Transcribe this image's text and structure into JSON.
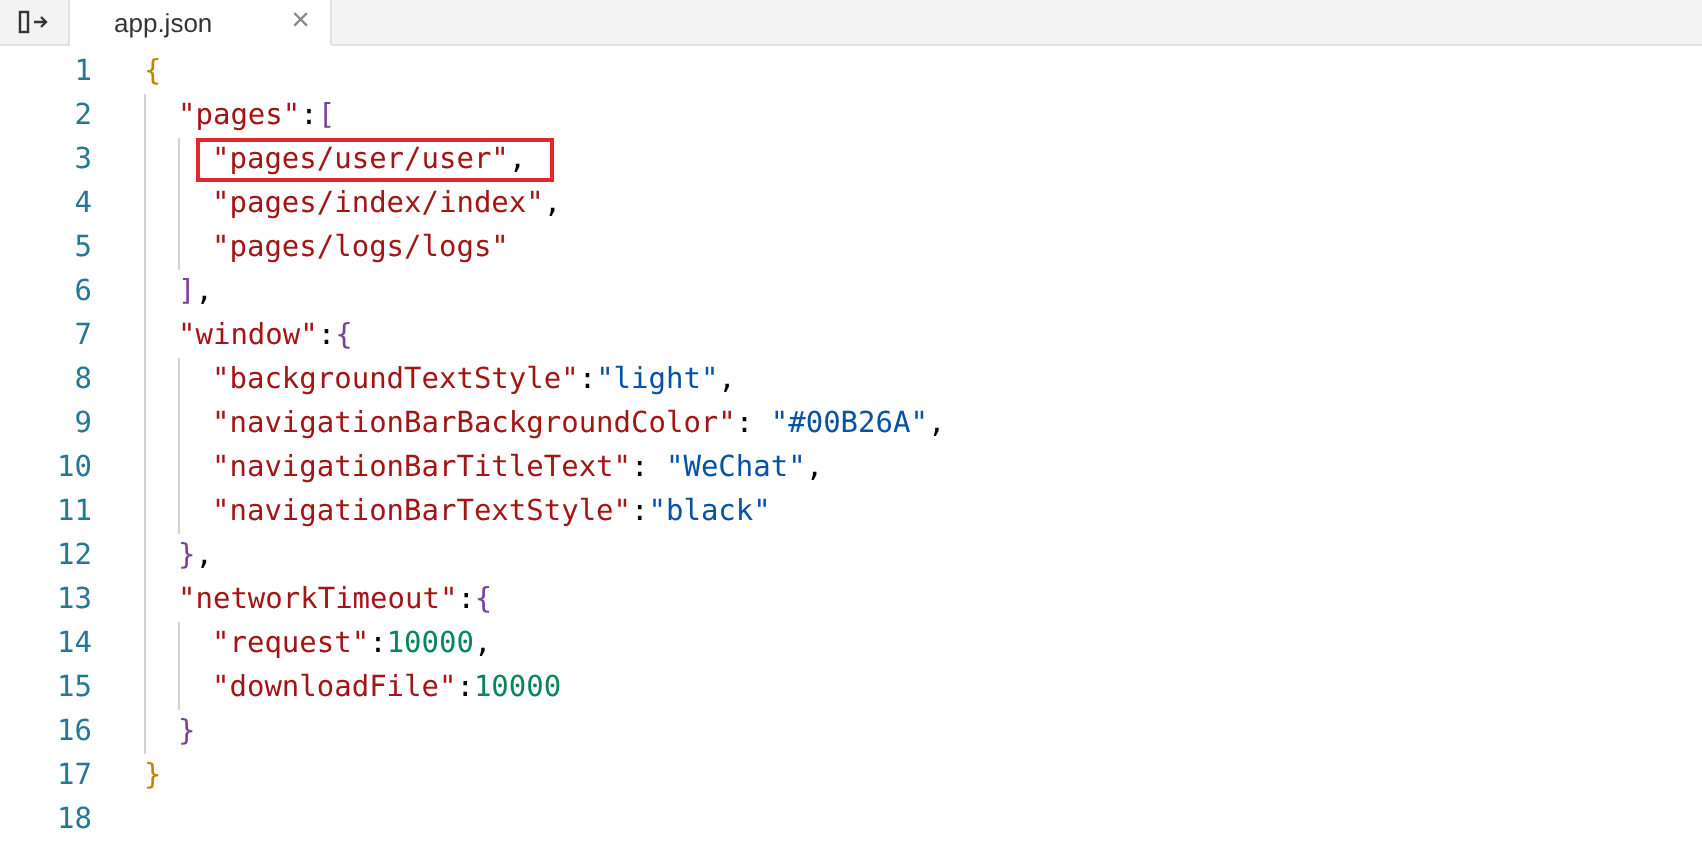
{
  "tabs": [
    {
      "label": "app.json",
      "selected": true,
      "close": "×"
    }
  ],
  "editor": {
    "lines": [
      {
        "number": "1",
        "highlighted": false,
        "tokens": [
          {
            "kind": "bracket1",
            "text": "{"
          }
        ],
        "children": [
          {
            "number": "2",
            "highlighted": false,
            "tokens": [
              {
                "kind": "key",
                "text": "\"pages\""
              },
              {
                "kind": "punct",
                "text": ":"
              },
              {
                "kind": "bracket2",
                "text": "["
              }
            ],
            "children": [
              {
                "number": "3",
                "highlighted": true,
                "tokens": [
                  {
                    "kind": "key",
                    "text": "\"pages/user/user\""
                  },
                  {
                    "kind": "punct",
                    "text": ","
                  }
                ]
              },
              {
                "number": "4",
                "highlighted": false,
                "tokens": [
                  {
                    "kind": "key",
                    "text": "\"pages/index/index\""
                  },
                  {
                    "kind": "punct",
                    "text": ","
                  }
                ]
              },
              {
                "number": "5",
                "highlighted": false,
                "tokens": [
                  {
                    "kind": "key",
                    "text": "\"pages/logs/logs\""
                  }
                ]
              }
            ]
          },
          {
            "number": "6",
            "highlighted": false,
            "tokens": [
              {
                "kind": "bracket2",
                "text": "]"
              },
              {
                "kind": "punct",
                "text": ","
              }
            ]
          },
          {
            "number": "7",
            "highlighted": false,
            "tokens": [
              {
                "kind": "key",
                "text": "\"window\""
              },
              {
                "kind": "punct",
                "text": ":"
              },
              {
                "kind": "bracket2",
                "text": "{"
              }
            ],
            "children": [
              {
                "number": "8",
                "highlighted": false,
                "tokens": [
                  {
                    "kind": "key",
                    "text": "\"backgroundTextStyle\""
                  },
                  {
                    "kind": "punct",
                    "text": ":"
                  },
                  {
                    "kind": "string",
                    "text": "\"light\""
                  },
                  {
                    "kind": "punct",
                    "text": ","
                  }
                ]
              },
              {
                "number": "9",
                "highlighted": false,
                "tokens": [
                  {
                    "kind": "key",
                    "text": "\"navigationBarBackgroundColor\""
                  },
                  {
                    "kind": "punct",
                    "text": ": "
                  },
                  {
                    "kind": "string",
                    "text": "\"#00B26A\""
                  },
                  {
                    "kind": "punct",
                    "text": ","
                  }
                ]
              },
              {
                "number": "10",
                "highlighted": false,
                "tokens": [
                  {
                    "kind": "key",
                    "text": "\"navigationBarTitleText\""
                  },
                  {
                    "kind": "punct",
                    "text": ": "
                  },
                  {
                    "kind": "string",
                    "text": "\"WeChat\""
                  },
                  {
                    "kind": "punct",
                    "text": ","
                  }
                ]
              },
              {
                "number": "11",
                "highlighted": false,
                "tokens": [
                  {
                    "kind": "key",
                    "text": "\"navigationBarTextStyle\""
                  },
                  {
                    "kind": "punct",
                    "text": ":"
                  },
                  {
                    "kind": "string",
                    "text": "\"black\""
                  }
                ]
              }
            ]
          },
          {
            "number": "12",
            "highlighted": false,
            "tokens": [
              {
                "kind": "bracket2",
                "text": "}"
              },
              {
                "kind": "punct",
                "text": ","
              }
            ]
          },
          {
            "number": "13",
            "highlighted": false,
            "tokens": [
              {
                "kind": "key",
                "text": "\"networkTimeout\""
              },
              {
                "kind": "punct",
                "text": ":"
              },
              {
                "kind": "bracket2",
                "text": "{"
              }
            ],
            "children": [
              {
                "number": "14",
                "highlighted": false,
                "tokens": [
                  {
                    "kind": "key",
                    "text": "\"request\""
                  },
                  {
                    "kind": "punct",
                    "text": ":"
                  },
                  {
                    "kind": "number",
                    "text": "10000"
                  },
                  {
                    "kind": "punct",
                    "text": ","
                  }
                ]
              },
              {
                "number": "15",
                "highlighted": false,
                "tokens": [
                  {
                    "kind": "key",
                    "text": "\"downloadFile\""
                  },
                  {
                    "kind": "punct",
                    "text": ":"
                  },
                  {
                    "kind": "number",
                    "text": "10000"
                  }
                ]
              }
            ]
          },
          {
            "number": "16",
            "highlighted": false,
            "tokens": [
              {
                "kind": "bracket2",
                "text": "}"
              }
            ]
          }
        ]
      },
      {
        "number": "17",
        "highlighted": false,
        "tokens": [
          {
            "kind": "bracket1",
            "text": "}"
          }
        ]
      },
      {
        "number": "18",
        "highlighted": false
      }
    ]
  }
}
